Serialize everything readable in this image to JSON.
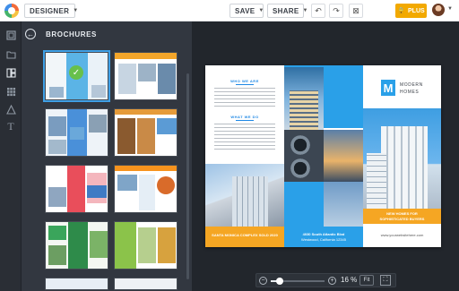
{
  "topbar": {
    "mode_label": "DESIGNER",
    "save_label": "SAVE",
    "share_label": "SHARE",
    "plus_label": "PLUS",
    "undo_icon": "undo-icon",
    "redo_icon": "redo-icon",
    "delete_icon": "delete-icon"
  },
  "rail": {
    "items": [
      "layout-icon",
      "folder-icon",
      "templates-icon",
      "grid-icon",
      "shapes-icon",
      "text-icon"
    ]
  },
  "panel": {
    "title": "BROCHURES",
    "thumbnails": [
      {
        "accent": "#5bb4e6",
        "selected": true
      },
      {
        "accent": "#f4a62a",
        "selected": false
      },
      {
        "accent": "#4a90d9",
        "selected": false
      },
      {
        "accent": "#e59b3a",
        "selected": false
      },
      {
        "accent": "#e94e5b",
        "selected": false
      },
      {
        "accent": "#f7931e",
        "selected": false
      },
      {
        "accent": "#3aa55b",
        "selected": false
      },
      {
        "accent": "#8bc34a",
        "selected": false
      }
    ]
  },
  "brochure": {
    "heading_who": "WHO WE ARE",
    "heading_what": "WHAT WE DO",
    "logo_letter": "M",
    "brand_line1": "MODERN",
    "brand_line2": "HOMES",
    "banner_left": "SANTA MONICA COMPLEX SOLD 2020",
    "address_line1": "4030 South Atlantic Blvd",
    "address_line2": "Westwood, California 12345",
    "banner_right_line1": "NEW HOMES FOR",
    "banner_right_line2": "SOPHISTICATED BUYERS",
    "website": "www.yourwebsitehere.com",
    "accent_blue": "#2aa0e8",
    "accent_orange": "#f5a623"
  },
  "zoom": {
    "value_label": "16 %",
    "fit_label": "Fit",
    "level": 0.16
  }
}
